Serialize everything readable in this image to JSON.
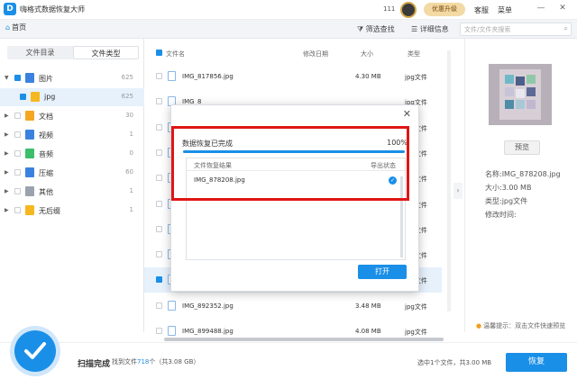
{
  "app": {
    "title": "嗨格式数据恢复大师",
    "number": "111",
    "upgrade_label": "优惠升级",
    "support_label": "客服",
    "menu_label": "菜单",
    "minimize": "—",
    "close": "✕"
  },
  "toolbar": {
    "home_label": "首页",
    "filter_label": "筛选查找",
    "detail_label": "详细信息",
    "search_placeholder": "文件/文件夹搜索"
  },
  "left": {
    "tabs": [
      "文件目录",
      "文件类型"
    ],
    "active_tab": 1,
    "tree": [
      {
        "label": "图片",
        "count": "625",
        "color": "#3b82e0",
        "checked": true
      },
      {
        "label": "jpg",
        "count": "625",
        "color": "#f5b820",
        "checked": true,
        "child": true
      },
      {
        "label": "文档",
        "count": "30",
        "color": "#f5a623",
        "checked": false
      },
      {
        "label": "视频",
        "count": "1",
        "color": "#3b82e0",
        "checked": false
      },
      {
        "label": "音频",
        "count": "0",
        "color": "#3bbf6a",
        "checked": false
      },
      {
        "label": "压缩",
        "count": "60",
        "color": "#3b82e0",
        "checked": false
      },
      {
        "label": "其他",
        "count": "1",
        "color": "#9aa3ad",
        "checked": false
      },
      {
        "label": "无后缀",
        "count": "1",
        "color": "#f5b820",
        "checked": false
      }
    ]
  },
  "table": {
    "headers": {
      "name": "文件名",
      "modified": "修改日期",
      "size": "大小",
      "type": "类型"
    },
    "rows": [
      {
        "name": "IMG_817856.jpg",
        "size": "4.30 MB",
        "type": "jpg文件"
      },
      {
        "name": "IMG_8",
        "size": "",
        "type": "jpg文件"
      },
      {
        "name": "",
        "size": "",
        "type": "jpg文件"
      },
      {
        "name": "",
        "size": "",
        "type": "jpg文件"
      },
      {
        "name": "",
        "size": "",
        "type": "jpg文件"
      },
      {
        "name": "",
        "size": "",
        "type": "jpg文件"
      },
      {
        "name": "",
        "size": "",
        "type": "jpg文件"
      },
      {
        "name": "",
        "size": "",
        "type": "jpg文件"
      },
      {
        "name": "",
        "size": "",
        "type": "jpg文件"
      },
      {
        "name": "IMG_892352.jpg",
        "size": "3.48 MB",
        "type": "jpg文件"
      },
      {
        "name": "IMG_899488.jpg",
        "size": "4.08 MB",
        "type": "jpg文件"
      }
    ]
  },
  "details": {
    "preview_label": "预览",
    "name": "名称:IMG_878208.jpg",
    "size": "大小:3.00 MB",
    "type": "类型:jpg文件",
    "modified": "修改时间:",
    "tip": "温馨提示：双击文件快速预览"
  },
  "status": {
    "scan_done": "扫描完成",
    "found_prefix": "找到文件",
    "found_count": "718",
    "found_suffix": "个（共3.08 GB）",
    "selected": "选中1个文件，共3.00 MB",
    "restore_label": "恢复"
  },
  "dialog": {
    "title": "数据恢复已完成",
    "percent": "100%",
    "progress": 1.0,
    "col_result": "文件恢复结果",
    "col_status": "导出状态",
    "result_file": "IMG_878208.jpg",
    "open_label": "打开",
    "close": "✕"
  },
  "colors": {
    "accent": "#1a8fe8",
    "highlight": "#e01515"
  }
}
